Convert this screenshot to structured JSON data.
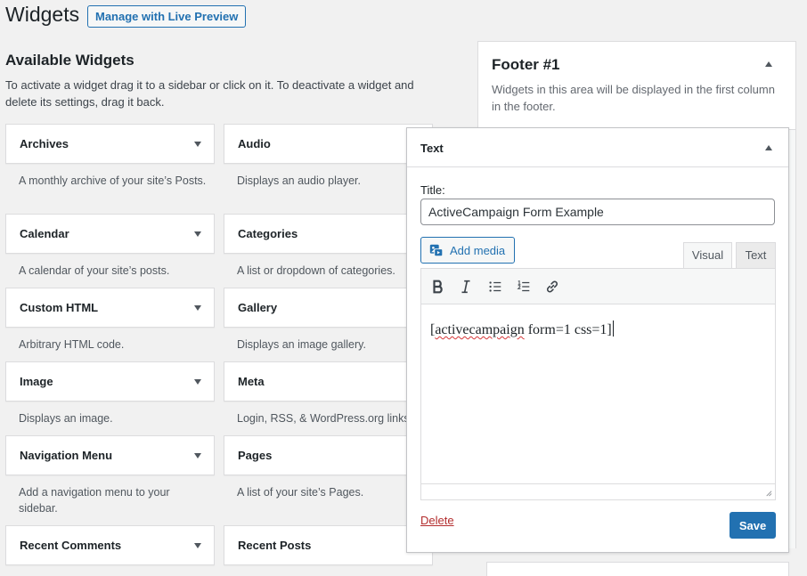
{
  "page": {
    "title": "Widgets",
    "live_preview": "Manage with Live Preview"
  },
  "available": {
    "title": "Available Widgets",
    "description": "To activate a widget drag it to a sidebar or click on it. To deactivate a widget and delete its settings, drag it back."
  },
  "widgets": [
    {
      "name": "Archives",
      "desc": "A monthly archive of your site’s Posts."
    },
    {
      "name": "Audio",
      "desc": "Displays an audio player."
    },
    {
      "name": "Calendar",
      "desc": "A calendar of your site’s posts."
    },
    {
      "name": "Categories",
      "desc": "A list or dropdown of categories."
    },
    {
      "name": "Custom HTML",
      "desc": "Arbitrary HTML code."
    },
    {
      "name": "Gallery",
      "desc": "Displays an image gallery."
    },
    {
      "name": "Image",
      "desc": "Displays an image."
    },
    {
      "name": "Meta",
      "desc": "Login, RSS, & WordPress.org links."
    },
    {
      "name": "Navigation Menu",
      "desc": "Add a navigation menu to your sidebar."
    },
    {
      "name": "Pages",
      "desc": "A list of your site’s Pages."
    },
    {
      "name": "Recent Comments",
      "desc": ""
    },
    {
      "name": "Recent Posts",
      "desc": ""
    }
  ],
  "sidebar": {
    "title": "Footer #1",
    "description": "Widgets in this area will be displayed in the first column in the footer."
  },
  "text_widget": {
    "title": "Text",
    "title_label": "Title:",
    "title_value": "ActiveCampaign Form Example",
    "add_media": "Add media",
    "tab_visual": "Visual",
    "tab_text": "Text",
    "content_open": "[",
    "content_spell": "activecampaign",
    "content_rest": " form=1 css=1]",
    "delete": "Delete",
    "save": "Save"
  },
  "icons": {
    "add_media": "add-media-icon",
    "bold": "bold-icon",
    "italic": "italic-icon",
    "bullet_list": "bullet-list-icon",
    "numbered_list": "numbered-list-icon",
    "link": "link-icon"
  },
  "colors": {
    "accent": "#2271b1",
    "delete": "#b32d2e",
    "background": "#f1f1f1"
  }
}
